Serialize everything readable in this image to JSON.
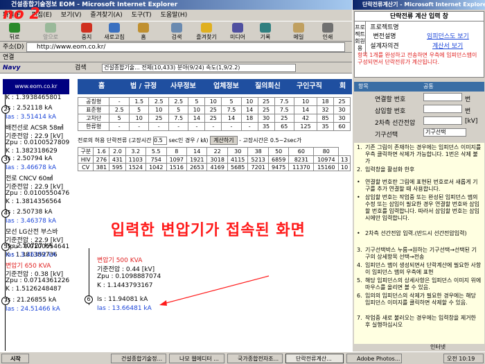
{
  "ie": {
    "title": "건설종합기술정보 EOM - Microsoft Internet Explorer",
    "menu": [
      "파일(F)",
      "편집(E)",
      "보기(V)",
      "즐겨찾기(A)",
      "도구(T)",
      "도움말(H)"
    ],
    "toolbar": [
      "뒤로",
      "앞으로",
      "중지",
      "새로고침",
      "홈",
      "검색",
      "즐겨찾기",
      "미디어",
      "기록",
      "메일",
      "인쇄"
    ],
    "addr_label": "주소(D)",
    "url": "http://www.eom.co.kr/",
    "links_label": "연결",
    "navy_label": "Navy",
    "navy_search": "검색",
    "navy_text": "건설종합기술...  전체(10,433) 분야(9/24) 속도(1,9/2.2)",
    "logo": "www.eom.co.kr",
    "nav": [
      "홈",
      "법 / 규정",
      "사무정보",
      "업체정보",
      "질의회신",
      "구인구직",
      "회"
    ]
  },
  "overlay": {
    "no2": "no 2",
    "big": "입력한 변압기가 접속된 화면"
  },
  "grid1": {
    "rows": [
      [
        "공칭형",
        "-",
        "1.5",
        "2.5",
        "2.5",
        "5",
        "10",
        "5",
        "10",
        "25",
        "7.5",
        "10",
        "18",
        "25"
      ],
      [
        "표준형",
        "2.5",
        "5",
        "10",
        "5",
        "10",
        "25",
        "7.5",
        "14",
        "25",
        "7.5",
        "14",
        "32",
        "30"
      ],
      [
        "고차단",
        "5",
        "10",
        "25",
        "7.5",
        "14",
        "25",
        "14",
        "18",
        "30",
        "25",
        "42",
        "85",
        "30"
      ],
      [
        "한류형",
        "-",
        "-",
        "-",
        "-",
        "-",
        "-",
        "-",
        "-",
        "35",
        "65",
        "125",
        "35",
        "60"
      ]
    ]
  },
  "calc": {
    "label1": "전로의 허용 단락전류 (고장시간",
    "val": "0.5",
    "label2": "sec인 경우 / ㎄)",
    "btn": "계산하기",
    "label3": "- 고장시간은 0.5~2sec가"
  },
  "grid2": {
    "rows": [
      [
        "구분",
        "1.6",
        "2.0",
        "3.2",
        "5.5",
        "8",
        "14",
        "22",
        "30",
        "38",
        "50",
        "60",
        "80"
      ],
      [
        "HIV",
        "276",
        "431",
        "1103",
        "754",
        "1097",
        "1921",
        "3018",
        "4115",
        "5213",
        "6859",
        "8231",
        "10974",
        "13"
      ],
      [
        "CV",
        "381",
        "595",
        "1524",
        "1042",
        "1516",
        "2653",
        "4169",
        "5685",
        "7201",
        "9475",
        "11370",
        "15160",
        "10"
      ]
    ]
  },
  "left": {
    "k0": "K : 1.3938465801",
    "s1": "Is : 2.52118 kA",
    "s1b": "Ias : 3.51414 kA",
    "s1c": "배전선로 ACSR 58㎟",
    "s1d": "기준전압 : 22.9 [kV]",
    "s1e": "Zpu : 0.0100527809",
    "s1f": "K : 1.382318629",
    "s2": "Is : 2.50794 kA",
    "s2b": "Ias : 3.46678 kA",
    "s2c": "전로 CNCV 60㎟",
    "s2d": "기준전압 : 22.9 [kV]",
    "s2e": "Zpu : 0.0100550476",
    "s2f": "K : 1.3814356564",
    "s3": "Is : 2.50738 kA",
    "s3b": "Ias : 3.46378 kA",
    "s3c": "모선 LG산전 부스바",
    "s3d": "기준전압 : 22.9 [kV]",
    "s3e": "Zpu : 0.0100554641",
    "s3f": "K : 1.381389736",
    "s4": "Is : 2.50727 kA",
    "s4b": "Ias : 3.46352 kA",
    "s4c": "변압기 650 KVA",
    "s4d": "기준전압 : 0.38 [kV]",
    "s4e": "Zpu : 0.0714361226",
    "s4f": "K : 1.5126248487",
    "s5": "Is : 21.26855 kA",
    "s5b": "Ias : 24.51466 kA",
    "n": [
      "2",
      "3",
      "4",
      "5",
      "7",
      "6"
    ],
    "r1": "변압기 500 KVA",
    "r2": "기준전압 : 0.44 [kV]",
    "r3": "Zpu : 0.1098887074",
    "r4": "K : 1.1443793167",
    "r5": "Is : 11.94081 kA",
    "r6": "Ias : 13.66481 kA"
  },
  "pop": {
    "title": "단락전류계산기 - Microsoft Internet Explorer",
    "head": "단락전류 계산 입력 창",
    "side": "프로젝트회원용",
    "rows": [
      [
        "프로젝트명",
        ""
      ],
      [
        "변전설명",
        "임피던스도 보기"
      ],
      [
        "설계자의견",
        "계산서 보기"
      ]
    ],
    "notice": "항목 1개를 완성하고 전송하면 우측에 임피던스맵이 구성되면서 단락전류가 계산됩니다.",
    "col1": "항목",
    "col2": "공통",
    "f1": "연결할 번호",
    "f1u": "번",
    "f2": "삽입할 번호",
    "f2u": "번",
    "f3": "2차측 선간전압",
    "f3u": "[kV]",
    "f4": "기구선택",
    "f4v": "기구선택",
    "steps": [
      "기존 그림이 존재하는 경우에는 임피던스 이미지를 우측 클릭하면 삭제가 가능합니다. 1번은 삭제 불가",
      "입력창을 활성화 한후",
      "연결할 번호란 그림에 표현된 번호로서 새롭게 기구를 추가 연결할 때 사용합니다.",
      "삽입할 번호는 작업중 또는 완성된 임피던스 맵의 수정 또는 삽입이 필요한 경우 연결할 번호와 삽입할 번호를 입력합니다. 따라서 삽입할 번호는 삽입시에만 입력합니다.",
      "2차측 선간전압 입력.(반드시 선간전압입력)",
      "기구선택박스 누름→원하는 기구선택→선택된 기구의 상세항목 선택→전송",
      "임피던스 맵이 생성되면서 단락계산에 필요한 사항이 임피던스 맵의 우측에 표현",
      "해당 임피던스의 상세사항은 임피던스 이미지 위에 마우스를 올리면 볼 수 있음.",
      "임의의 임피던스의 삭제가 필요한 경우에는 해당 임피던스 이미지를 클릭하면 삭제할 수 있음.",
      "작업중 새로 불러오는 경우에는 입력창을 제거한 후 실행하십시오"
    ],
    "status": "인터넷"
  },
  "task": {
    "start": "시작",
    "items": [
      "건설종합기술정...",
      "나모 웹에디터 ...",
      "국가종합전자조...",
      "단락전류계산...",
      "Adobe Photos..."
    ],
    "clock": "오전 10:19"
  }
}
